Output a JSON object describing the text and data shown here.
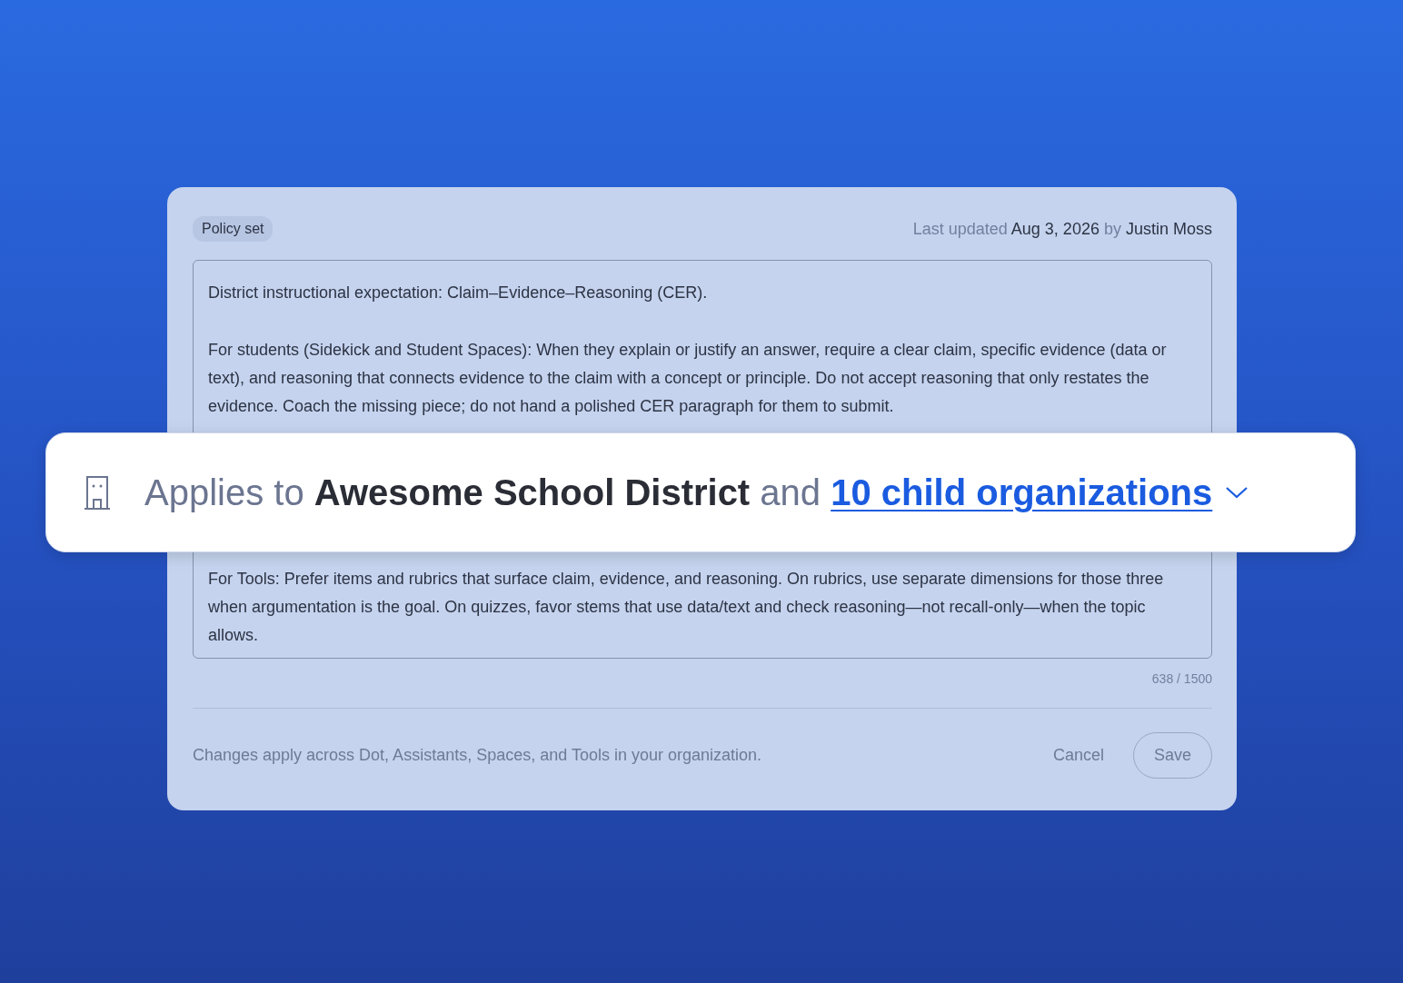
{
  "policy_card": {
    "badge": "Policy set",
    "last_updated": {
      "prefix": "Last updated",
      "date": "Aug 3, 2026",
      "by": "by",
      "author": "Justin Moss"
    },
    "policy_text": {
      "paragraphs_before": [
        "District instructional expectation: Claim–Evidence–Reasoning (CER).",
        "For students (Sidekick and Student Spaces): When they explain or justify an answer, require a clear claim, specific evidence (data or text), and reasoning that connects evidence to the claim with a concept or principle. Do not accept reasoning that only restates the evidence. Coach the missing piece; do not hand a polished CER paragraph for them to submit."
      ],
      "paragraphs_after": [
        "For Tools: Prefer items and rubrics that surface claim, evidence, and reasoning. On rubrics, use separate dimensions for those three when argumentation is the goal. On quizzes, favor stems that use data/text and check reasoning—not recall-only—when the topic allows."
      ]
    },
    "character_count": "638 / 1500",
    "footer_note": "Changes apply across Dot, Assistants, Spaces, and Tools in your organization.",
    "buttons": [
      {
        "kind": "text",
        "label": "Cancel"
      },
      {
        "kind": "outlined",
        "label": "Save"
      }
    ]
  },
  "scope_banner": {
    "prefix": "Applies to",
    "organization": "Awesome School District",
    "conjunction": "and",
    "link": "10 child organizations"
  }
}
